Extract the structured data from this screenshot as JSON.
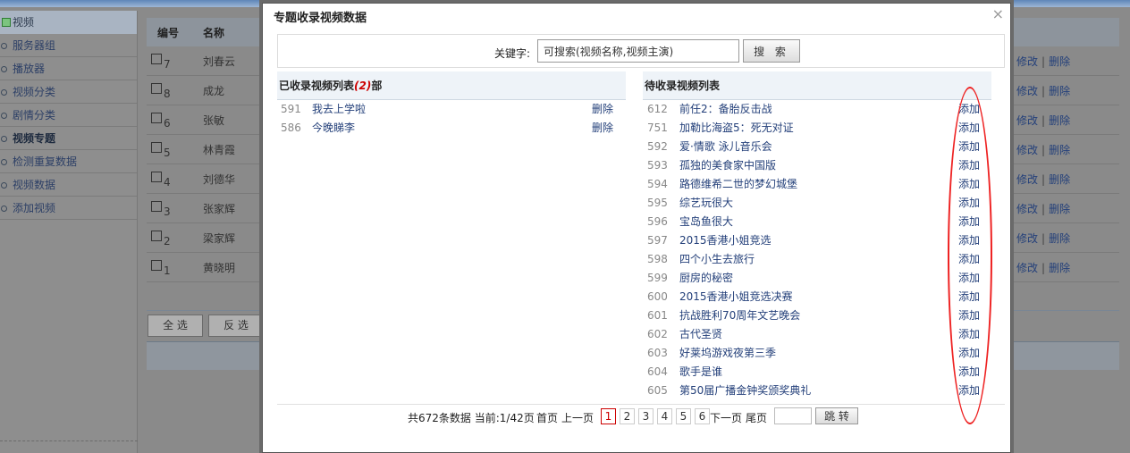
{
  "sidebar": {
    "title": "视频",
    "items": [
      {
        "label": "服务器组",
        "active": false
      },
      {
        "label": "播放器",
        "active": false
      },
      {
        "label": "视频分类",
        "active": false
      },
      {
        "label": "剧情分类",
        "active": false
      },
      {
        "label": "视频专题",
        "active": true
      },
      {
        "label": "检测重复数据",
        "active": false
      },
      {
        "label": "视频数据",
        "active": false
      },
      {
        "label": "添加视频",
        "active": false
      }
    ]
  },
  "bg_table": {
    "col_id": "编号",
    "col_name": "名称",
    "edit_label": "修改",
    "sep": "|",
    "delete_label": "删除",
    "rows": [
      {
        "id": "7",
        "name": "刘春云"
      },
      {
        "id": "8",
        "name": "成龙"
      },
      {
        "id": "6",
        "name": "张敏"
      },
      {
        "id": "5",
        "name": "林青霞"
      },
      {
        "id": "4",
        "name": "刘德华"
      },
      {
        "id": "3",
        "name": "张家辉"
      },
      {
        "id": "2",
        "name": "梁家辉"
      },
      {
        "id": "1",
        "name": "黄晓明"
      }
    ],
    "select_all": "全 选",
    "invert": "反 选"
  },
  "modal": {
    "title": "专题收录视频数据",
    "close": "×",
    "keyword_label": "关键字:",
    "keyword_value": "可搜索(视频名称,视频主演)",
    "search_button": "搜 索",
    "included": {
      "title_prefix": "已收录视频列表",
      "count": "(2)",
      "title_suffix": "部",
      "action": "删除",
      "items": [
        {
          "id": "591",
          "name": "我去上学啦"
        },
        {
          "id": "586",
          "name": "今晚睇李"
        }
      ]
    },
    "pending": {
      "title": "待收录视频列表",
      "action": "添加",
      "items": [
        {
          "id": "612",
          "name": "前任2：备胎反击战"
        },
        {
          "id": "751",
          "name": "加勒比海盗5：死无对证"
        },
        {
          "id": "592",
          "name": "爱·情歌 泳儿音乐会"
        },
        {
          "id": "593",
          "name": "孤独的美食家中国版"
        },
        {
          "id": "594",
          "name": "路德维希二世的梦幻城堡"
        },
        {
          "id": "595",
          "name": "综艺玩很大"
        },
        {
          "id": "596",
          "name": "宝岛鱼很大"
        },
        {
          "id": "597",
          "name": "2015香港小姐竞选"
        },
        {
          "id": "598",
          "name": "四个小生去旅行"
        },
        {
          "id": "599",
          "name": "厨房的秘密"
        },
        {
          "id": "600",
          "name": "2015香港小姐竞选决赛"
        },
        {
          "id": "601",
          "name": "抗战胜利70周年文艺晚会"
        },
        {
          "id": "602",
          "name": "古代圣贤"
        },
        {
          "id": "603",
          "name": "好莱坞游戏夜第三季"
        },
        {
          "id": "604",
          "name": "歌手是谁"
        },
        {
          "id": "605",
          "name": "第50届广播金钟奖颁奖典礼"
        }
      ]
    },
    "pager": {
      "summary": "共672条数据 当前:1/42页",
      "first": "首页",
      "prev": "上一页",
      "pages": [
        "1",
        "2",
        "3",
        "4",
        "5",
        "6"
      ],
      "current": "1",
      "next": "下一页",
      "last": "尾页",
      "jump": "跳 转"
    }
  },
  "colors": {
    "annotation": "#ee2222",
    "link": "#24407a",
    "count_red": "#cc0000"
  }
}
